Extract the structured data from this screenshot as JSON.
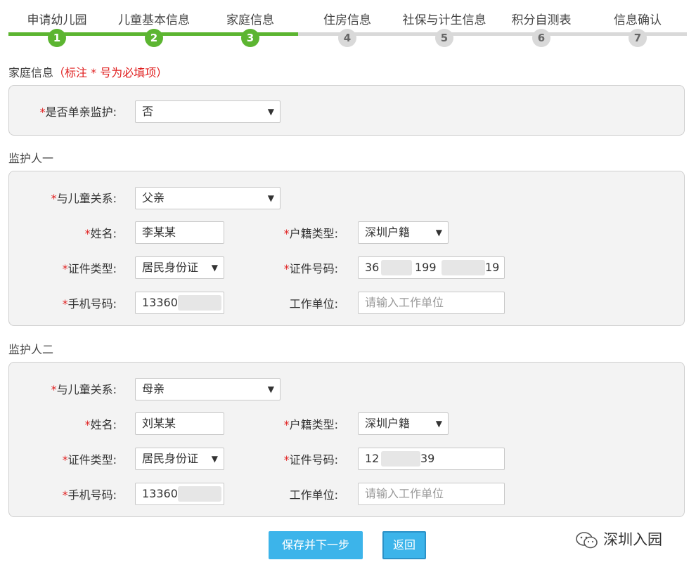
{
  "colors": {
    "accent": "#5cb531",
    "required": "#e02020",
    "button": "#3cb4ea"
  },
  "stepper": {
    "current_step": 3,
    "steps": [
      {
        "label": "申请幼儿园",
        "num": "1"
      },
      {
        "label": "儿童基本信息",
        "num": "2"
      },
      {
        "label": "家庭信息",
        "num": "3"
      },
      {
        "label": "住房信息",
        "num": "4"
      },
      {
        "label": "社保与计生信息",
        "num": "5"
      },
      {
        "label": "积分自测表",
        "num": "6"
      },
      {
        "label": "信息确认",
        "num": "7"
      }
    ]
  },
  "family": {
    "heading": "家庭信息",
    "required_note": "（标注 * 号为必填项）",
    "single_parent": {
      "label": "是否单亲监护:",
      "value": "否"
    }
  },
  "guardian1": {
    "heading": "监护人一",
    "relation": {
      "label": "与儿童关系:",
      "value": "父亲"
    },
    "name": {
      "label": "姓名:",
      "value": "李某某"
    },
    "hukou": {
      "label": "户籍类型:",
      "value": "深圳户籍"
    },
    "id_type": {
      "label": "证件类型:",
      "value": "居民身份证"
    },
    "id_number": {
      "label": "证件号码:",
      "part1": "36",
      "part2": "199",
      "part3": "19"
    },
    "phone": {
      "label": "手机号码:",
      "value": "13360"
    },
    "work_unit": {
      "label": "工作单位:",
      "placeholder": "请输入工作单位"
    }
  },
  "guardian2": {
    "heading": "监护人二",
    "relation": {
      "label": "与儿童关系:",
      "value": "母亲"
    },
    "name": {
      "label": "姓名:",
      "value": "刘某某"
    },
    "hukou": {
      "label": "户籍类型:",
      "value": "深圳户籍"
    },
    "id_type": {
      "label": "证件类型:",
      "value": "居民身份证"
    },
    "id_number": {
      "label": "证件号码:",
      "part1": "12",
      "part2": "39"
    },
    "phone": {
      "label": "手机号码:",
      "value": "13360"
    },
    "work_unit": {
      "label": "工作单位:",
      "placeholder": "请输入工作单位"
    }
  },
  "buttons": {
    "save_next": "保存并下一步",
    "back": "返回"
  },
  "footer": {
    "brand": "深圳入园"
  },
  "star": "*"
}
